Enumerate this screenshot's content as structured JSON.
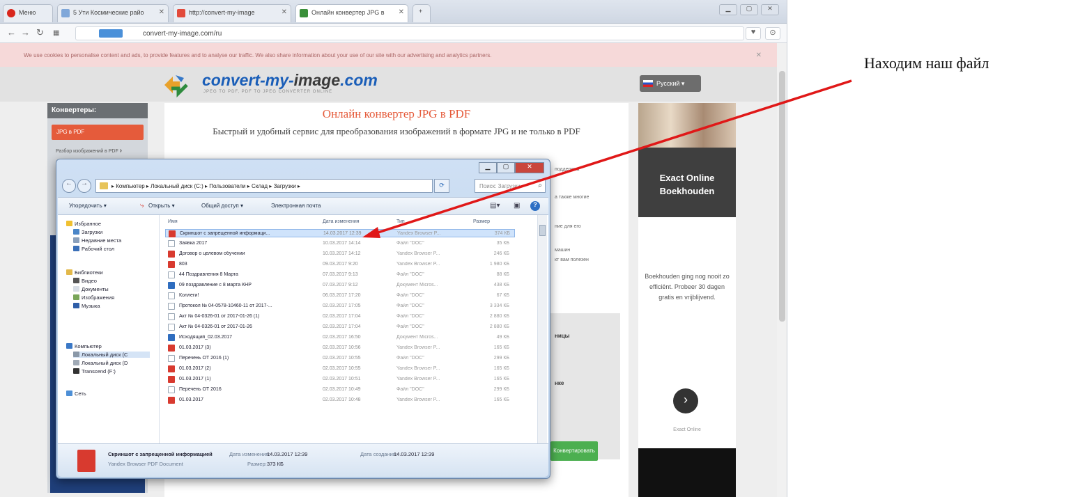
{
  "browser": {
    "tabs": [
      {
        "label": "Меню"
      },
      {
        "label": "5 Ути Космические райо"
      },
      {
        "label": "http://convert-my-image"
      },
      {
        "label": "Онлайн конвертер JPG в"
      }
    ],
    "url": "convert-my-image.com/ru",
    "cookie_notice": "We use cookies to personalise content and ads, to provide features and to analyse our traffic. We also share information about your use of our site with our advertising and analytics partners."
  },
  "site": {
    "logo": {
      "part1": "convert-my-",
      "part2": "image",
      "part3": ".com",
      "tagline": "JPEG TO PDF, PDF TO JPEG CONVERTER ONLINE"
    },
    "language": "Русский",
    "sidebar": {
      "heading": "Конвертеры:",
      "active_item": "JPG в PDF",
      "item": "Разбор изображений в PDF"
    },
    "title": "Онлайн конвертер JPG в PDF",
    "subtitle": "Быстрый и удобный сервис для преобразования изображений в формате JPG и не только в PDF",
    "bg_snippets": [
      "поддержка",
      "а также многие",
      "ние для его",
      "машин",
      "кт вам полезен"
    ],
    "bg_bold": [
      "ницы",
      "нке"
    ],
    "convert_button": "Конвертировать",
    "ad": {
      "headline": "Exact Online Boekhouden",
      "body": "Boekhouden ging nog nooit zo efficiënt. Probeer 30 dagen gratis en vrijblijvend.",
      "link": "Exact Online"
    }
  },
  "dialog": {
    "breadcrumb": "▸ Компьютер ▸ Локальный диск (C:) ▸ Пользователи ▸ Склад ▸ Загрузки ▸",
    "search_placeholder": "Поиск: Загрузки",
    "toolbar": {
      "organize": "Упорядочить ▾",
      "open": "Открыть ▾",
      "share": "Общий доступ ▾",
      "email": "Электронная почта"
    },
    "nav": {
      "favorites": "Избранное",
      "downloads": "Загрузки",
      "recent": "Недавние места",
      "desktop": "Рабочий стол",
      "libraries": "Библиотеки",
      "video": "Видео",
      "documents": "Документы",
      "images": "Изображения",
      "music": "Музыка",
      "computer": "Компьютер",
      "disk_c": "Локальный диск (C",
      "disk_d": "Локальный диск (D",
      "transcend": "Transcend (F:)",
      "network": "Сеть"
    },
    "columns": {
      "name": "Имя",
      "date": "Дата изменения",
      "type": "Тип",
      "size": "Размер"
    },
    "files": [
      {
        "name": "Скриншот с запрещенной информаци...",
        "date": "14.03.2017 12:39",
        "type": "Yandex Browser P...",
        "size": "374 КБ",
        "icon": "pdf"
      },
      {
        "name": "Заявка 2017",
        "date": "10.03.2017 14:14",
        "type": "Файл \"DOC\"",
        "size": "35 КБ",
        "icon": "doc"
      },
      {
        "name": "Договор о целевом обучении",
        "date": "10.03.2017 14:12",
        "type": "Yandex Browser P...",
        "size": "246 КБ",
        "icon": "pdf"
      },
      {
        "name": "803",
        "date": "09.03.2017 9:20",
        "type": "Yandex Browser P...",
        "size": "1 980 КБ",
        "icon": "pdf"
      },
      {
        "name": "44 Поздравления 8 Марта",
        "date": "07.03.2017 9:13",
        "type": "Файл \"DOC\"",
        "size": "88 КБ",
        "icon": "doc"
      },
      {
        "name": "09 поздравление с 8 марта КНР",
        "date": "07.03.2017 9:12",
        "type": "Документ Micros...",
        "size": "438 КБ",
        "icon": "docx"
      },
      {
        "name": "Коллеги!",
        "date": "06.03.2017 17:20",
        "type": "Файл \"DOC\"",
        "size": "67 КБ",
        "icon": "doc"
      },
      {
        "name": "Протокол № 04-0578-10460-11 от 2017-...",
        "date": "02.03.2017 17:05",
        "type": "Файл \"DOC\"",
        "size": "3 334 КБ",
        "icon": "doc"
      },
      {
        "name": "Акт № 04-0326-01 от 2017-01-26 (1)",
        "date": "02.03.2017 17:04",
        "type": "Файл \"DOC\"",
        "size": "2 880 КБ",
        "icon": "doc"
      },
      {
        "name": "Акт № 04-0326-01 от 2017-01-26",
        "date": "02.03.2017 17:04",
        "type": "Файл \"DOC\"",
        "size": "2 880 КБ",
        "icon": "doc"
      },
      {
        "name": "Исходящий_02.03.2017",
        "date": "02.03.2017 16:50",
        "type": "Документ Micros...",
        "size": "49 КБ",
        "icon": "docx"
      },
      {
        "name": "01.03.2017 (3)",
        "date": "02.03.2017 10:56",
        "type": "Yandex Browser P...",
        "size": "165 КБ",
        "icon": "pdf"
      },
      {
        "name": "Перечень ОТ 2016 (1)",
        "date": "02.03.2017 10:55",
        "type": "Файл \"DOC\"",
        "size": "299 КБ",
        "icon": "doc"
      },
      {
        "name": "01.03.2017 (2)",
        "date": "02.03.2017 10:55",
        "type": "Yandex Browser P...",
        "size": "165 КБ",
        "icon": "pdf"
      },
      {
        "name": "01.03.2017 (1)",
        "date": "02.03.2017 10:51",
        "type": "Yandex Browser P...",
        "size": "165 КБ",
        "icon": "pdf"
      },
      {
        "name": "Перечень ОТ 2016",
        "date": "02.03.2017 10:49",
        "type": "Файл \"DOC\"",
        "size": "299 КБ",
        "icon": "doc"
      },
      {
        "name": "01.03.2017",
        "date": "02.03.2017 10:48",
        "type": "Yandex Browser P...",
        "size": "165 КБ",
        "icon": "pdf"
      }
    ],
    "details": {
      "filename": "Скриншот с запрещенной информацией",
      "modified_label": "Дата изменения:",
      "modified": "14.03.2017 12:39",
      "created_label": "Дата создания:",
      "created": "14.03.2017 12:39",
      "type": "Yandex Browser PDF Document",
      "size_label": "Размер:",
      "size": "373 КБ"
    }
  },
  "annotation": {
    "text": "Находим наш файл",
    "color": "#e01818"
  },
  "colors": {
    "accent": "#e55b3b",
    "logo_blue": "#1a5eb8",
    "convert_green": "#4caf50"
  }
}
